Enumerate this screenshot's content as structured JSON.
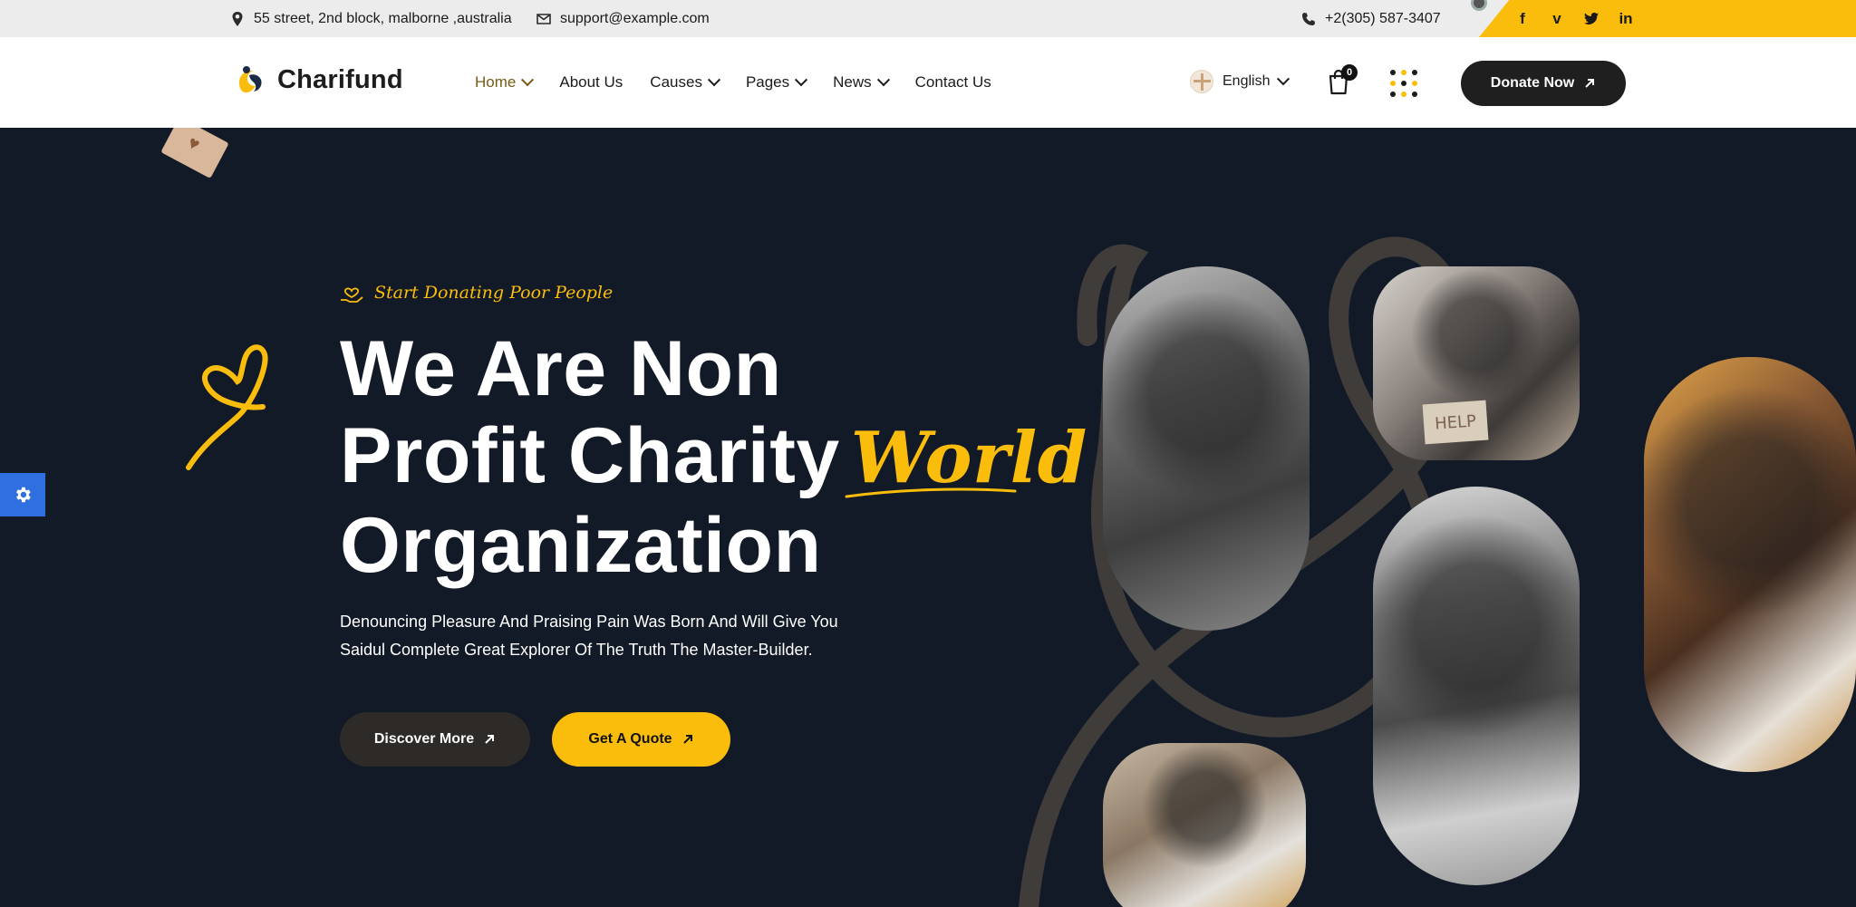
{
  "topbar": {
    "address": "55 street, 2nd block, malborne ,australia",
    "email": "support@example.com",
    "phone": "+2(305) 587-3407",
    "social": [
      "f",
      "v",
      "t",
      "in"
    ]
  },
  "header": {
    "brand": "Charifund",
    "nav": [
      {
        "label": "Home",
        "dropdown": true
      },
      {
        "label": "About Us",
        "dropdown": false
      },
      {
        "label": "Causes",
        "dropdown": true
      },
      {
        "label": "Pages",
        "dropdown": true
      },
      {
        "label": "News",
        "dropdown": true
      },
      {
        "label": "Contact Us",
        "dropdown": false
      }
    ],
    "language": "English",
    "cart_count": "0",
    "donate_label": "Donate Now"
  },
  "hero": {
    "tagline": "Start Donating Poor People",
    "headline_line1": "We Are Non",
    "headline_line2": "Profit Charity",
    "headline_highlight": "World",
    "headline_line3": "Organization",
    "description_line1": "Denouncing Pleasure And Praising Pain Was Born And Will Give You",
    "description_line2": "Saidul Complete Great Explorer Of The Truth The Master-Builder.",
    "discover_label": "Discover More",
    "quote_label": "Get A Quote",
    "help_sign": "HELP"
  },
  "colors": {
    "accent": "#fbbd0b",
    "hero_bg": "#131a27",
    "dark_button": "#1f1f1f",
    "settings_tab": "#2f6fe0"
  },
  "icons": [
    "location-pin-icon",
    "envelope-icon",
    "phone-icon",
    "facebook-icon",
    "vimeo-icon",
    "twitter-icon",
    "linkedin-icon",
    "cart-icon",
    "grid-menu-icon",
    "arrow-up-right-icon",
    "gear-icon",
    "heart-hand-icon",
    "heart-scribble-icon"
  ]
}
